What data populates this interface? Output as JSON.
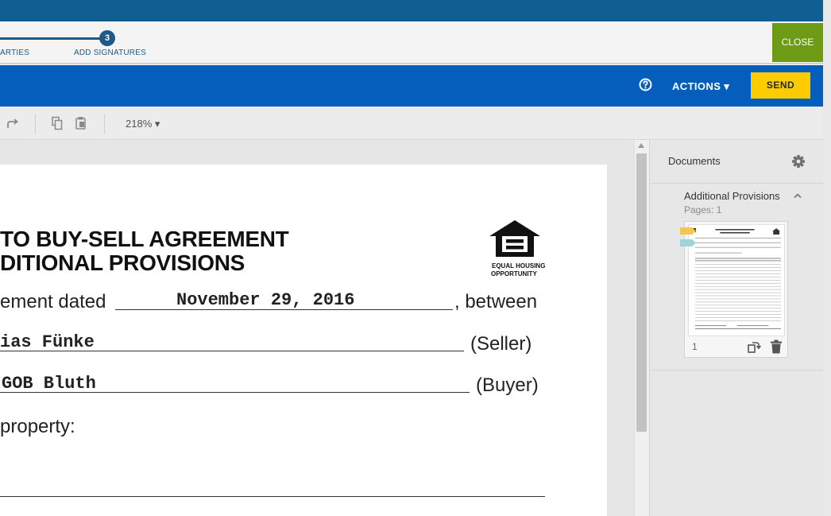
{
  "steps": {
    "prev_label": "ARTIES",
    "current_number": "3",
    "current_label": "ADD SIGNATURES"
  },
  "header": {
    "close_label": "CLOSE",
    "actions_label": "ACTIONS ▾",
    "send_label": "SEND"
  },
  "toolbar": {
    "zoom": "218% ▾",
    "icons": [
      "redo-icon",
      "copy-icon",
      "paste-icon"
    ]
  },
  "document": {
    "title_line1": "TO BUY-SELL AGREEMENT",
    "title_line2": "DITIONAL PROVISIONS",
    "logo_text_line1": "EQUAL HOUSING",
    "logo_text_line2": "OPPORTUNITY",
    "row1_prefix": "ement dated",
    "row1_value": "November 29, 2016",
    "row1_suffix": ", between",
    "seller_value": "ias  Fünke",
    "seller_label": "(Seller)",
    "buyer_value": "GOB  Bluth",
    "buyer_label": "(Buyer)",
    "property_label": "property:"
  },
  "sidebar": {
    "title": "Documents",
    "doc_name": "Additional Provisions",
    "pages": "Pages: 1",
    "page_number": "1"
  },
  "colors": {
    "topbar": "#0f5f92",
    "actionbar": "#055ebb",
    "send": "#fccb00",
    "close": "#6e9b16"
  }
}
